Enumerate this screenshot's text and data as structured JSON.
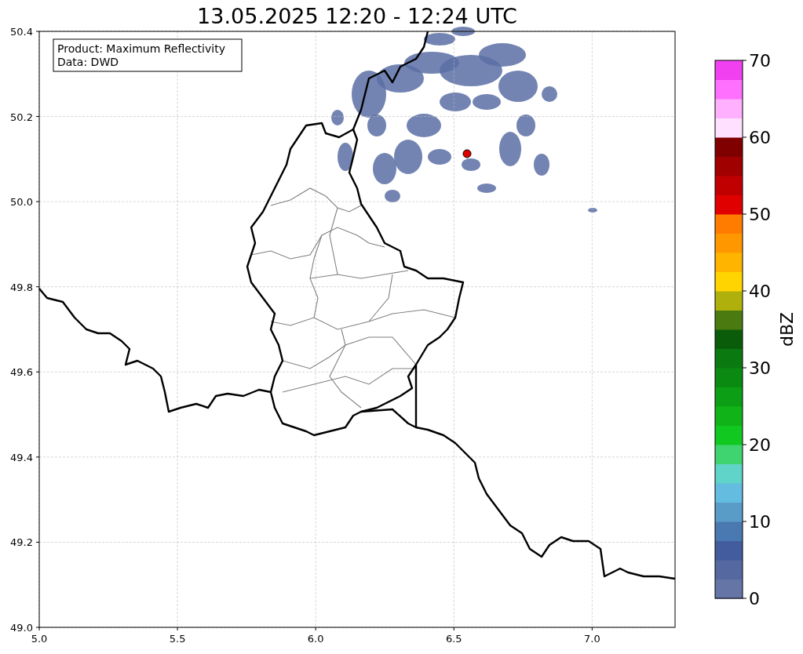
{
  "title": "13.05.2025 12:20 - 12:24 UTC",
  "info_box": [
    "Product: Maximum Reflectivity",
    "Data: DWD"
  ],
  "map": {
    "xticks": [
      "5.0",
      "5.5",
      "6.0",
      "6.5",
      "7.0"
    ],
    "yticks": [
      "50.4",
      "50.2",
      "50.0",
      "49.8",
      "49.6",
      "49.4",
      "49.2",
      "49.0"
    ]
  },
  "colorbar": {
    "label": "dBZ",
    "ticks": [
      "70",
      "60",
      "50",
      "40",
      "30",
      "20",
      "10",
      "0"
    ],
    "segments": [
      {
        "color": "#6475a6"
      },
      {
        "color": "#5568a0"
      },
      {
        "color": "#425c9e"
      },
      {
        "color": "#4a78b0"
      },
      {
        "color": "#5a9cc8"
      },
      {
        "color": "#64bce0"
      },
      {
        "color": "#60d4c8"
      },
      {
        "color": "#40d470"
      },
      {
        "color": "#10c820"
      },
      {
        "color": "#10b418"
      },
      {
        "color": "#0c9e14"
      },
      {
        "color": "#0a8a10"
      },
      {
        "color": "#0a7a10"
      },
      {
        "color": "#0a5c0a"
      },
      {
        "color": "#4a7a10"
      },
      {
        "color": "#b0b00c"
      },
      {
        "color": "#ffd400"
      },
      {
        "color": "#ffb400"
      },
      {
        "color": "#ff9800"
      },
      {
        "color": "#ff7c00"
      },
      {
        "color": "#e00000"
      },
      {
        "color": "#c00000"
      },
      {
        "color": "#a00000"
      },
      {
        "color": "#800000"
      },
      {
        "color": "#ffe0ff"
      },
      {
        "color": "#ffb0ff"
      },
      {
        "color": "#ff70ff"
      },
      {
        "color": "#f040f0"
      }
    ]
  }
}
